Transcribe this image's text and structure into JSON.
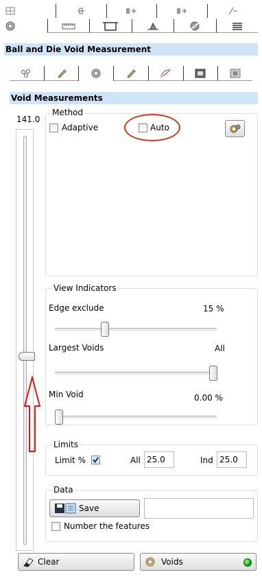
{
  "top_tabs": {
    "row1": [
      "tab-1",
      "tab-2",
      "tab-3",
      "tab-4",
      "tab-5"
    ],
    "row2": [
      "tab-6",
      "tab-7",
      "tab-8",
      "tab-9",
      "tab-10",
      "tab-11"
    ]
  },
  "panel_title": "Ball and Die Void Measurement",
  "section_title": "Void Measurements",
  "slider_value": "141.0",
  "method": {
    "legend": "Method",
    "adaptive_label": "Adaptive",
    "adaptive_checked": false,
    "auto_label": "Auto",
    "auto_checked": false
  },
  "view_indicators": {
    "legend": "View Indicators",
    "edge_exclude_label": "Edge exclude",
    "edge_exclude_value": "15 %",
    "edge_exclude_position": 0.3,
    "largest_voids_label": "Largest Voids",
    "largest_voids_value": "All",
    "largest_voids_position": 1.0,
    "min_void_label": "Min Void",
    "min_void_value": "0.00 %",
    "min_void_position": 0.0
  },
  "limits": {
    "legend": "Limits",
    "limit_pct_label": "Limit %",
    "limit_pct_checked": true,
    "all_label": "All",
    "all_value": "25.0",
    "ind_label": "Ind",
    "ind_value": "25.0"
  },
  "data_group": {
    "legend": "Data",
    "save_label": "Save",
    "filename_value": "",
    "number_features_label": "Number the features",
    "number_features_checked": false
  },
  "footer": {
    "clear_label": "Clear",
    "voids_label": "Voids"
  },
  "vertical_slider_position": 0.55
}
